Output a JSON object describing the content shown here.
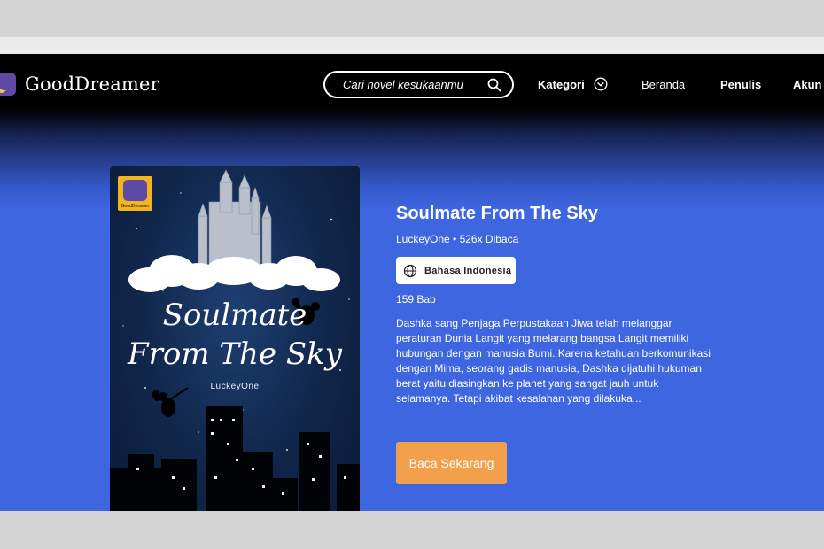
{
  "header": {
    "logo_text": "GoodDreamer",
    "search_placeholder": "Cari novel kesukaanmu",
    "nav": {
      "kategori": "Kategori",
      "beranda": "Beranda",
      "penulis": "Penulis",
      "akun": "Akun"
    }
  },
  "book": {
    "title": "Soulmate From The Sky",
    "meta": "LuckeyOne • 526x Dibaca",
    "language": "Bahasa Indonesia",
    "chapters": "159 Bab",
    "synopsis": "Dashka sang Penjaga Perpustakaan Jiwa telah melanggar peraturan Dunia Langit yang melarang bangsa Langit memiliki hubungan dengan manusia Bumi. Karena ketahuan berkomunikasi dengan Mima, seorang gadis manusia, Dashka dijatuhi hukuman berat yaitu diasingkan ke planet yang sangat jauh untuk selamanya. Tetapi akibat kesalahan yang dilakuka...",
    "read_button": "Baca Sekarang",
    "cover": {
      "title_line1": "Soulmate",
      "title_line2": "From The Sky",
      "author": "LuckeyOne",
      "badge_text": "GoodDreamer"
    }
  },
  "colors": {
    "header_bg": "#000000",
    "hero_bg": "#3d66e0",
    "button_bg": "#f2a04c"
  }
}
